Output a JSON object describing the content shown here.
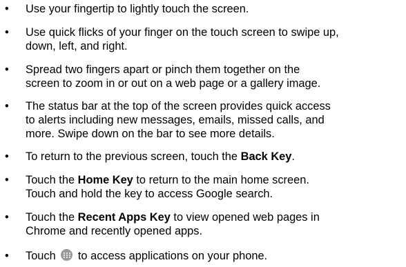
{
  "bullet_char": "•",
  "items": [
    {
      "lines": [
        "Use your fingertip to lightly touch the screen."
      ]
    },
    {
      "lines": [
        "Use quick flicks of your finger on the touch screen to swipe up,",
        "down, left, and right."
      ]
    },
    {
      "lines": [
        "Spread two fingers apart or pinch them together on the",
        "screen to zoom in or out on a web page or a gallery image."
      ]
    },
    {
      "lines": [
        "The status bar at the top of the screen provides quick access",
        "to alerts including new messages, emails, missed calls, and",
        "more. Swipe down on the bar to see more details."
      ]
    },
    {
      "before": "To return to the previous screen, touch the ",
      "bold": "Back Key",
      "after": "."
    },
    {
      "l1_before": "Touch the ",
      "l1_bold": "Home Key",
      "l1_after": " to return to the main home screen.",
      "l2": "Touch and hold the key to access Google search."
    },
    {
      "l1_before": "Touch the ",
      "l1_bold": "Recent Apps Key",
      "l1_after": " to view opened web pages in",
      "l2": "Chrome and recently opened apps."
    },
    {
      "before": "Touch ",
      "icon": "apps-icon",
      "after": " to access applications on your phone."
    }
  ]
}
